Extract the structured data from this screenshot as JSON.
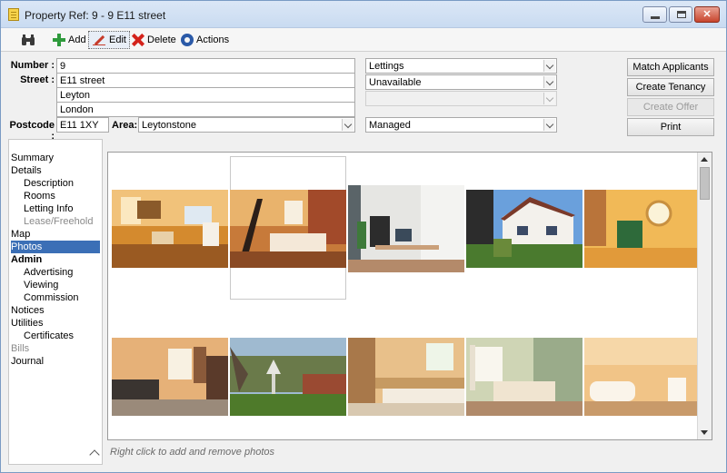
{
  "window": {
    "title": "Property Ref: 9 - 9 E11  street",
    "icon": "document-icon",
    "controls": [
      "minimize",
      "maximize",
      "close"
    ]
  },
  "toolbar": {
    "find_icon": "binoculars-icon",
    "add_label": "Add",
    "edit_label": "Edit",
    "delete_label": "Delete",
    "actions_label": "Actions"
  },
  "form": {
    "number_label": "Number :",
    "number_value": "9",
    "street_label": "Street :",
    "street_value": "E11  street",
    "address_line2": "Leyton",
    "address_line3": "London",
    "postcode_label": "Postcode :",
    "postcode_value": "E11 1XY",
    "area_label": "Area:",
    "area_value": "Leytonstone",
    "type_value": "Lettings",
    "status_value": "Unavailable",
    "status2_value": "",
    "management_value": "Managed"
  },
  "actions": {
    "match_applicants": "Match Applicants",
    "create_tenancy": "Create Tenancy",
    "create_offer": "Create Offer",
    "print": "Print"
  },
  "nav": {
    "items": [
      {
        "label": "Summary"
      },
      {
        "label": "Details"
      },
      {
        "label": "Description"
      },
      {
        "label": "Rooms"
      },
      {
        "label": "Letting Info"
      },
      {
        "label": "Lease/Freehold"
      },
      {
        "label": "Map"
      },
      {
        "label": "Photos"
      },
      {
        "label": "Admin"
      },
      {
        "label": "Advertising"
      },
      {
        "label": "Viewing"
      },
      {
        "label": "Commission"
      },
      {
        "label": "Notices"
      },
      {
        "label": "Utilities"
      },
      {
        "label": "Certificates"
      },
      {
        "label": "Bills"
      },
      {
        "label": "Journal"
      }
    ],
    "selected": "Photos"
  },
  "photos": {
    "hint": "Right click to add and remove photos",
    "items": [
      {
        "subject": "kitchen-diner"
      },
      {
        "subject": "bedroom-spiral-stair"
      },
      {
        "subject": "office-desk"
      },
      {
        "subject": "house-exterior"
      },
      {
        "subject": "empty-room-porthole"
      },
      {
        "subject": "living-room"
      },
      {
        "subject": "garden"
      },
      {
        "subject": "kitchen"
      },
      {
        "subject": "bedroom-green"
      },
      {
        "subject": "bathroom"
      }
    ]
  },
  "colors": {
    "selection": "#3b6fb6",
    "title_bar": "#c9dbf1",
    "close_button": "#c8452d"
  }
}
